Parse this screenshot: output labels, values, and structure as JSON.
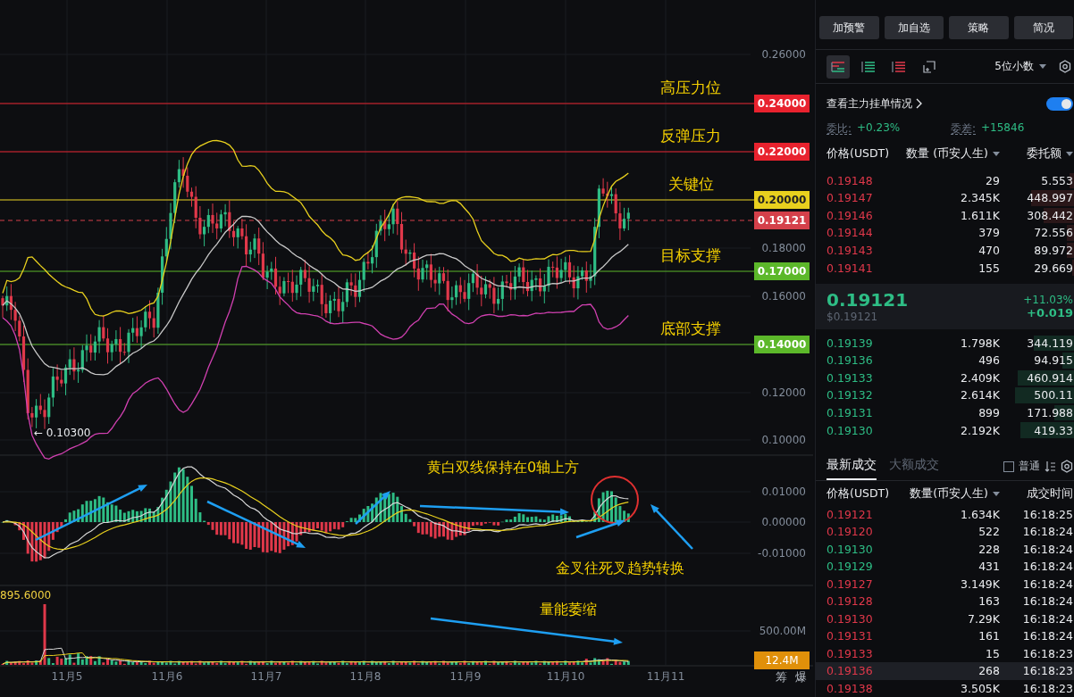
{
  "chart": {
    "levels": [
      {
        "kind": "solid",
        "label": "0.24000",
        "color": "#e8222e",
        "note": "高压力位"
      },
      {
        "kind": "solid",
        "label": "0.22000",
        "color": "#e8222e",
        "note": "反弹压力"
      },
      {
        "kind": "solid",
        "label": "0.20000",
        "color": "#e8d01e",
        "note": "关键位"
      },
      {
        "kind": "current",
        "label": "0.19121",
        "color": "#d4404a"
      },
      {
        "kind": "solid",
        "label": "0.17000",
        "color": "#5cb82a",
        "note": "目标支撑"
      },
      {
        "kind": "solid",
        "label": "0.14000",
        "color": "#5cb82a",
        "note": "底部支撑"
      }
    ],
    "price_ticks": [
      "0.26000",
      "0.18000",
      "0.16000",
      "0.12000",
      "0.10000"
    ],
    "low_marker": "← 0.10300",
    "macd_ticks": [
      "0.01000",
      "0.00000",
      "-0.01000"
    ],
    "volume_label": "895.6000",
    "volume_ticks": [
      "500.00M"
    ],
    "volume_tag": "12.4M",
    "annotations": [
      "黄白双线保持在0轴上方",
      "金叉往死叉趋势转换",
      "量能萎缩"
    ],
    "dates": [
      "11月5",
      "11月6",
      "11月7",
      "11月8",
      "11月9",
      "11月10",
      "11月11"
    ],
    "corner_buttons": [
      "筹",
      "爆"
    ]
  },
  "actions": [
    "加预警",
    "加自选",
    "策略",
    "简况"
  ],
  "order_book": {
    "views": [
      {
        "selected": true
      },
      {
        "selected": false
      },
      {
        "selected": false
      },
      {
        "selected": false
      }
    ],
    "precision": "5位小数",
    "main_orders": {
      "label": "查看主力挂单情况",
      "on": true
    },
    "ratio_label": "委比:",
    "ratio": "+0.23%",
    "diff_label": "委差:",
    "diff": "+15846",
    "columns": [
      "价格(USDT)",
      "数量 (币安人生)",
      "委托额"
    ],
    "asks": [
      {
        "price": "0.19148",
        "amount": "29",
        "total": "5.553",
        "level": 0.02
      },
      {
        "price": "0.19147",
        "amount": "2.345K",
        "total": "448.997",
        "level": 0.17
      },
      {
        "price": "0.19146",
        "amount": "1.611K",
        "total": "308.442",
        "level": 0.12
      },
      {
        "price": "0.19144",
        "amount": "379",
        "total": "72.556",
        "level": 0.03
      },
      {
        "price": "0.19143",
        "amount": "470",
        "total": "89.972",
        "level": 0.03
      },
      {
        "price": "0.19141",
        "amount": "155",
        "total": "29.669",
        "level": 0.01
      }
    ],
    "last_price": "0.19121",
    "last_price_usd": "$0.19121",
    "change_pct": "+11.03%",
    "change": "+0.019",
    "bids": [
      {
        "price": "0.19139",
        "amount": "1.798K",
        "total": "344.119",
        "level": 0.16
      },
      {
        "price": "0.19136",
        "amount": "496",
        "total": "94.915",
        "level": 0.05
      },
      {
        "price": "0.19133",
        "amount": "2.409K",
        "total": "460.914",
        "level": 0.22
      },
      {
        "price": "0.19132",
        "amount": "2.614K",
        "total": "500.11",
        "level": 0.23
      },
      {
        "price": "0.19131",
        "amount": "899",
        "total": "171.988",
        "level": 0.08
      },
      {
        "price": "0.19130",
        "amount": "2.192K",
        "total": "419.33",
        "level": 0.21
      }
    ]
  },
  "trades": {
    "tabs": [
      {
        "label": "最新成交",
        "selected": true
      },
      {
        "label": "大额成交",
        "selected": false
      }
    ],
    "filter": {
      "label": "普通",
      "checked": false
    },
    "columns": [
      "价格(USDT)",
      "数量(币安人生)",
      "成交时间"
    ],
    "rows": [
      {
        "kind": "sell",
        "price": "0.19121",
        "amount": "1.634K",
        "time": "16:18:25",
        "selected": false
      },
      {
        "kind": "sell",
        "price": "0.19120",
        "amount": "522",
        "time": "16:18:24",
        "selected": false
      },
      {
        "kind": "buy",
        "price": "0.19130",
        "amount": "228",
        "time": "16:18:24",
        "selected": false
      },
      {
        "kind": "buy",
        "price": "0.19129",
        "amount": "431",
        "time": "16:18:24",
        "selected": false
      },
      {
        "kind": "sell",
        "price": "0.19127",
        "amount": "3.149K",
        "time": "16:18:24",
        "selected": false
      },
      {
        "kind": "sell",
        "price": "0.19128",
        "amount": "163",
        "time": "16:18:24",
        "selected": false
      },
      {
        "kind": "sell",
        "price": "0.19130",
        "amount": "7.29K",
        "time": "16:18:24",
        "selected": false
      },
      {
        "kind": "sell",
        "price": "0.19131",
        "amount": "161",
        "time": "16:18:24",
        "selected": false
      },
      {
        "kind": "sell",
        "price": "0.19133",
        "amount": "15",
        "time": "16:18:23",
        "selected": false
      },
      {
        "kind": "sell",
        "price": "0.19136",
        "amount": "268",
        "time": "16:18:23",
        "selected": true
      },
      {
        "kind": "sell",
        "price": "0.19138",
        "amount": "3.505K",
        "time": "16:18:23",
        "selected": false
      }
    ]
  }
}
